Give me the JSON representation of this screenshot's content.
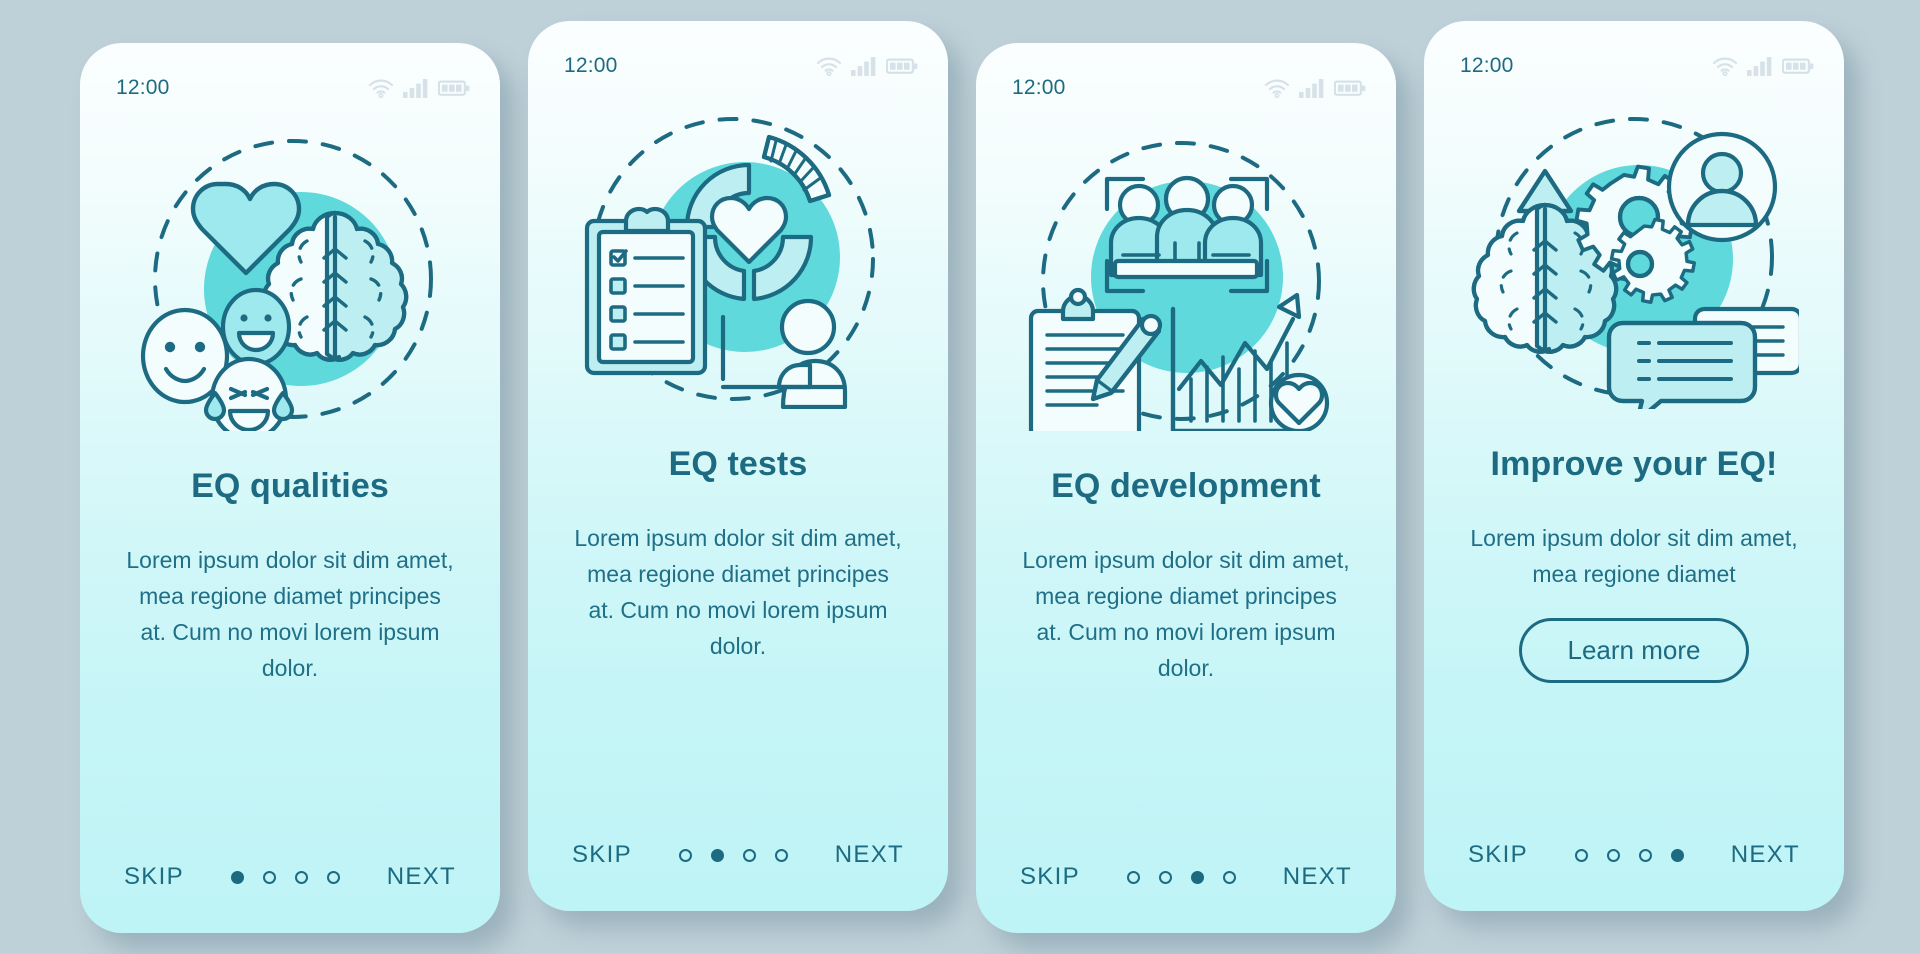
{
  "theme": {
    "page_background": "#bed0d8",
    "accent_teal": "#5fd9dc",
    "ink": "#1d6b82",
    "card_top": "#fbfeff",
    "card_bottom": "#bef4f6"
  },
  "status_bar": {
    "time": "12:00",
    "icons": [
      "wifi-icon",
      "signal-icon",
      "battery-icon"
    ],
    "signal_bars": 4,
    "battery_segments": 3
  },
  "nav": {
    "skip_label": "SKIP",
    "next_label": "NEXT",
    "dot_count": 4
  },
  "screens": [
    {
      "id": "eq-qualities",
      "illustration": "heart-brain-emoji-icon",
      "title": "EQ qualities",
      "description": "Lorem ipsum dolor sit dim amet, mea regione diamet principes at. Cum no movi lorem ipsum dolor.",
      "active_dot": 1,
      "cta": null
    },
    {
      "id": "eq-tests",
      "illustration": "clipboard-chart-person-icon",
      "title": "EQ tests",
      "description": "Lorem ipsum dolor sit dim amet, mea regione diamet principes at. Cum no movi lorem ipsum dolor.",
      "active_dot": 2,
      "cta": null
    },
    {
      "id": "eq-development",
      "illustration": "team-clipboard-growth-icon",
      "title": "EQ development",
      "description": "Lorem ipsum dolor sit dim amet, mea regione diamet principes at. Cum no movi lorem ipsum dolor.",
      "active_dot": 3,
      "cta": null
    },
    {
      "id": "improve-your-eq",
      "illustration": "brain-gears-chat-icon",
      "title": "Improve your EQ!",
      "description": "Lorem ipsum dolor sit dim amet, mea regione diamet",
      "active_dot": 4,
      "cta": "Learn more"
    }
  ]
}
